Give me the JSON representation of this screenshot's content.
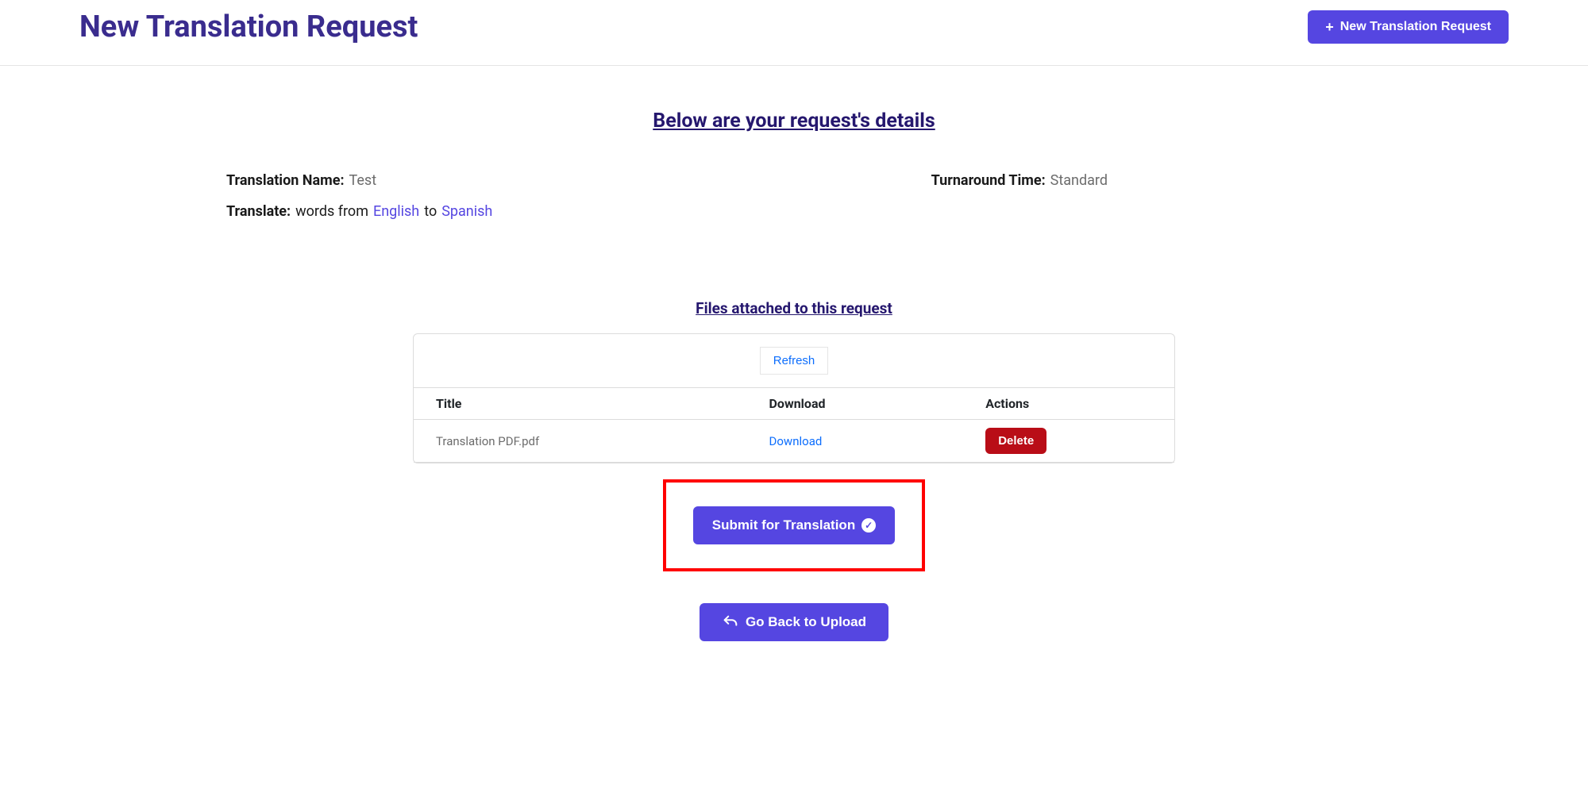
{
  "header": {
    "title": "New Translation Request",
    "new_button": "New Translation Request"
  },
  "details": {
    "heading": "Below are your request's details",
    "translation_name_label": "Translation Name:",
    "translation_name_value": "Test",
    "turnaround_label": "Turnaround Time:",
    "turnaround_value": "Standard",
    "translate_label": "Translate:",
    "translate_prefix": "words from",
    "translate_from": "English",
    "translate_mid": "to",
    "translate_to": "Spanish"
  },
  "files": {
    "heading": "Files attached to this request",
    "refresh": "Refresh",
    "columns": {
      "title": "Title",
      "download": "Download",
      "actions": "Actions"
    },
    "rows": [
      {
        "title": "Translation PDF.pdf",
        "download": "Download",
        "delete": "Delete"
      }
    ]
  },
  "actions": {
    "submit": "Submit for Translation",
    "go_back": "Go Back to Upload"
  }
}
